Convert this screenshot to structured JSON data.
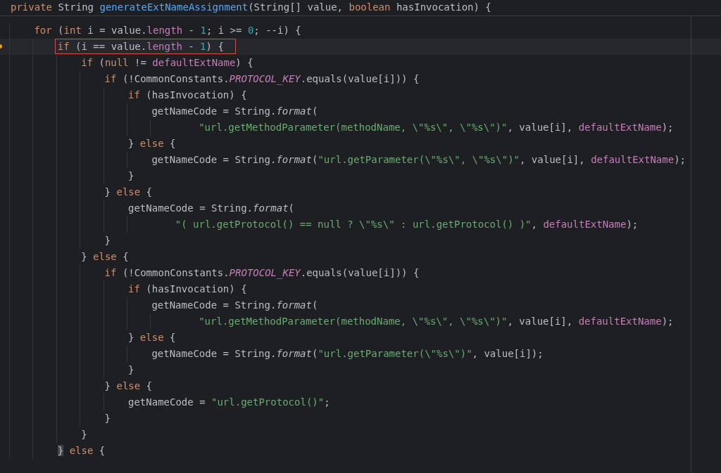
{
  "editor": {
    "header": {
      "tokens": [
        {
          "text": "private",
          "kind": "kw"
        },
        {
          "text": " String ",
          "kind": "p"
        },
        {
          "text": "generateExtNameAssignment",
          "kind": "fn"
        },
        {
          "text": "(String[] value, ",
          "kind": "p"
        },
        {
          "text": "boolean",
          "kind": "kw"
        },
        {
          "text": " hasInvocation) {",
          "kind": "p"
        }
      ]
    },
    "lines": [
      {
        "kind": "code",
        "current": false,
        "boxed": false,
        "marker": false,
        "tokens": [
          {
            "text": "for",
            "kind": "kw"
          },
          {
            "text": " (",
            "kind": "p"
          },
          {
            "text": "int",
            "kind": "kw"
          },
          {
            "text": " i = value.",
            "kind": "p"
          },
          {
            "text": "length",
            "kind": "f"
          },
          {
            "text": " - ",
            "kind": "p"
          },
          {
            "text": "1",
            "kind": "n"
          },
          {
            "text": "; i >= ",
            "kind": "p"
          },
          {
            "text": "0",
            "kind": "n"
          },
          {
            "text": "; --i) {",
            "kind": "p"
          }
        ],
        "children": [
          {
            "kind": "code",
            "current": true,
            "boxed": true,
            "marker": true,
            "tokens": [
              {
                "text": "if",
                "kind": "kw"
              },
              {
                "text": " (i == value.",
                "kind": "p"
              },
              {
                "text": "length",
                "kind": "f"
              },
              {
                "text": " - ",
                "kind": "p"
              },
              {
                "text": "1",
                "kind": "n"
              },
              {
                "text": ") {",
                "kind": "p"
              }
            ],
            "children": [
              {
                "kind": "code",
                "current": false,
                "boxed": false,
                "marker": false,
                "tokens": [
                  {
                    "text": "if",
                    "kind": "kw"
                  },
                  {
                    "text": " (",
                    "kind": "p"
                  },
                  {
                    "text": "null",
                    "kind": "kw"
                  },
                  {
                    "text": " != ",
                    "kind": "p"
                  },
                  {
                    "text": "defaultExtName",
                    "kind": "f"
                  },
                  {
                    "text": ") {",
                    "kind": "p"
                  }
                ],
                "children": [
                  {
                    "kind": "code",
                    "current": false,
                    "boxed": false,
                    "marker": false,
                    "tokens": [
                      {
                        "text": "if",
                        "kind": "kw"
                      },
                      {
                        "text": " (!CommonConstants.",
                        "kind": "p"
                      },
                      {
                        "text": "PROTOCOL_KEY",
                        "kind": "c"
                      },
                      {
                        "text": ".equals(value[i])) {",
                        "kind": "p"
                      }
                    ],
                    "children": [
                      {
                        "kind": "code",
                        "current": false,
                        "boxed": false,
                        "marker": false,
                        "tokens": [
                          {
                            "text": "if",
                            "kind": "kw"
                          },
                          {
                            "text": " (hasInvocation) {",
                            "kind": "p"
                          }
                        ],
                        "children": [
                          {
                            "kind": "code",
                            "current": false,
                            "boxed": false,
                            "marker": false,
                            "tokens": [
                              {
                                "text": "getNameCode = String.",
                                "kind": "p"
                              },
                              {
                                "text": "format",
                                "kind": "m"
                              },
                              {
                                "text": "(",
                                "kind": "p"
                              }
                            ],
                            "children": [
                              {
                                "kind": "continuation",
                                "current": false,
                                "boxed": false,
                                "marker": false,
                                "tokens": [
                                  {
                                    "text": "\"url.getMethodParameter(methodName, \\\"%s\\\", \\\"%s\\\")\"",
                                    "kind": "s"
                                  },
                                  {
                                    "text": ", value[i], ",
                                    "kind": "p"
                                  },
                                  {
                                    "text": "defaultExtName",
                                    "kind": "f"
                                  },
                                  {
                                    "text": ");",
                                    "kind": "p"
                                  }
                                ]
                              }
                            ]
                          }
                        ]
                      },
                      {
                        "kind": "code",
                        "current": false,
                        "boxed": false,
                        "marker": false,
                        "tokens": [
                          {
                            "text": "} ",
                            "kind": "p"
                          },
                          {
                            "text": "else",
                            "kind": "kw"
                          },
                          {
                            "text": " {",
                            "kind": "p"
                          }
                        ],
                        "children": [
                          {
                            "kind": "code",
                            "current": false,
                            "boxed": false,
                            "marker": false,
                            "tokens": [
                              {
                                "text": "getNameCode = String.",
                                "kind": "p"
                              },
                              {
                                "text": "format",
                                "kind": "m"
                              },
                              {
                                "text": "(",
                                "kind": "p"
                              },
                              {
                                "text": "\"url.getParameter(\\\"%s\\\", \\\"%s\\\")\"",
                                "kind": "s"
                              },
                              {
                                "text": ", value[i], ",
                                "kind": "p"
                              },
                              {
                                "text": "defaultExtName",
                                "kind": "f"
                              },
                              {
                                "text": ");",
                                "kind": "p"
                              }
                            ]
                          }
                        ]
                      },
                      {
                        "kind": "code",
                        "current": false,
                        "boxed": false,
                        "marker": false,
                        "tokens": [
                          {
                            "text": "}",
                            "kind": "p"
                          }
                        ]
                      }
                    ]
                  },
                  {
                    "kind": "code",
                    "current": false,
                    "boxed": false,
                    "marker": false,
                    "tokens": [
                      {
                        "text": "} ",
                        "kind": "p"
                      },
                      {
                        "text": "else",
                        "kind": "kw"
                      },
                      {
                        "text": " {",
                        "kind": "p"
                      }
                    ],
                    "children": [
                      {
                        "kind": "code",
                        "current": false,
                        "boxed": false,
                        "marker": false,
                        "tokens": [
                          {
                            "text": "getNameCode = String.",
                            "kind": "p"
                          },
                          {
                            "text": "format",
                            "kind": "m"
                          },
                          {
                            "text": "(",
                            "kind": "p"
                          }
                        ],
                        "children": [
                          {
                            "kind": "continuation",
                            "current": false,
                            "boxed": false,
                            "marker": false,
                            "tokens": [
                              {
                                "text": "\"( url.getProtocol() == null ? \\\"%s\\\" : url.getProtocol() )\"",
                                "kind": "s"
                              },
                              {
                                "text": ", ",
                                "kind": "p"
                              },
                              {
                                "text": "defaultExtName",
                                "kind": "f"
                              },
                              {
                                "text": ");",
                                "kind": "p"
                              }
                            ]
                          }
                        ]
                      }
                    ]
                  },
                  {
                    "kind": "code",
                    "current": false,
                    "boxed": false,
                    "marker": false,
                    "tokens": [
                      {
                        "text": "}",
                        "kind": "p"
                      }
                    ]
                  }
                ]
              },
              {
                "kind": "code",
                "current": false,
                "boxed": false,
                "marker": false,
                "tokens": [
                  {
                    "text": "} ",
                    "kind": "p"
                  },
                  {
                    "text": "else",
                    "kind": "kw"
                  },
                  {
                    "text": " {",
                    "kind": "p"
                  }
                ],
                "children": [
                  {
                    "kind": "code",
                    "current": false,
                    "boxed": false,
                    "marker": false,
                    "tokens": [
                      {
                        "text": "if",
                        "kind": "kw"
                      },
                      {
                        "text": " (!CommonConstants.",
                        "kind": "p"
                      },
                      {
                        "text": "PROTOCOL_KEY",
                        "kind": "c"
                      },
                      {
                        "text": ".equals(value[i])) {",
                        "kind": "p"
                      }
                    ],
                    "children": [
                      {
                        "kind": "code",
                        "current": false,
                        "boxed": false,
                        "marker": false,
                        "tokens": [
                          {
                            "text": "if",
                            "kind": "kw"
                          },
                          {
                            "text": " (hasInvocation) {",
                            "kind": "p"
                          }
                        ],
                        "children": [
                          {
                            "kind": "code",
                            "current": false,
                            "boxed": false,
                            "marker": false,
                            "tokens": [
                              {
                                "text": "getNameCode = String.",
                                "kind": "p"
                              },
                              {
                                "text": "format",
                                "kind": "m"
                              },
                              {
                                "text": "(",
                                "kind": "p"
                              }
                            ],
                            "children": [
                              {
                                "kind": "continuation",
                                "current": false,
                                "boxed": false,
                                "marker": false,
                                "tokens": [
                                  {
                                    "text": "\"url.getMethodParameter(methodName, \\\"%s\\\", \\\"%s\\\")\"",
                                    "kind": "s"
                                  },
                                  {
                                    "text": ", value[i], ",
                                    "kind": "p"
                                  },
                                  {
                                    "text": "defaultExtName",
                                    "kind": "f"
                                  },
                                  {
                                    "text": ");",
                                    "kind": "p"
                                  }
                                ]
                              }
                            ]
                          }
                        ]
                      },
                      {
                        "kind": "code",
                        "current": false,
                        "boxed": false,
                        "marker": false,
                        "tokens": [
                          {
                            "text": "} ",
                            "kind": "p"
                          },
                          {
                            "text": "else",
                            "kind": "kw"
                          },
                          {
                            "text": " {",
                            "kind": "p"
                          }
                        ],
                        "children": [
                          {
                            "kind": "code",
                            "current": false,
                            "boxed": false,
                            "marker": false,
                            "tokens": [
                              {
                                "text": "getNameCode = String.",
                                "kind": "p"
                              },
                              {
                                "text": "format",
                                "kind": "m"
                              },
                              {
                                "text": "(",
                                "kind": "p"
                              },
                              {
                                "text": "\"url.getParameter(\\\"%s\\\")\"",
                                "kind": "s"
                              },
                              {
                                "text": ", value[i]);",
                                "kind": "p"
                              }
                            ]
                          }
                        ]
                      },
                      {
                        "kind": "code",
                        "current": false,
                        "boxed": false,
                        "marker": false,
                        "tokens": [
                          {
                            "text": "}",
                            "kind": "p"
                          }
                        ]
                      }
                    ]
                  },
                  {
                    "kind": "code",
                    "current": false,
                    "boxed": false,
                    "marker": false,
                    "tokens": [
                      {
                        "text": "} ",
                        "kind": "p"
                      },
                      {
                        "text": "else",
                        "kind": "kw"
                      },
                      {
                        "text": " {",
                        "kind": "p"
                      }
                    ],
                    "children": [
                      {
                        "kind": "code",
                        "current": false,
                        "boxed": false,
                        "marker": false,
                        "tokens": [
                          {
                            "text": "getNameCode = ",
                            "kind": "p"
                          },
                          {
                            "text": "\"url.getProtocol()\"",
                            "kind": "s"
                          },
                          {
                            "text": ";",
                            "kind": "p"
                          }
                        ]
                      }
                    ]
                  },
                  {
                    "kind": "code",
                    "current": false,
                    "boxed": false,
                    "marker": false,
                    "tokens": [
                      {
                        "text": "}",
                        "kind": "p"
                      }
                    ]
                  }
                ]
              },
              {
                "kind": "code",
                "current": false,
                "boxed": false,
                "marker": false,
                "tokens": [
                  {
                    "text": "}",
                    "kind": "p"
                  }
                ]
              }
            ]
          },
          {
            "kind": "code",
            "current": false,
            "boxed": false,
            "marker": false,
            "tokens": [
              {
                "text": "}",
                "kind": "b"
              },
              {
                "text": " else",
                "kind": "kw"
              },
              {
                "text": " {",
                "kind": "p"
              }
            ]
          }
        ]
      }
    ]
  }
}
